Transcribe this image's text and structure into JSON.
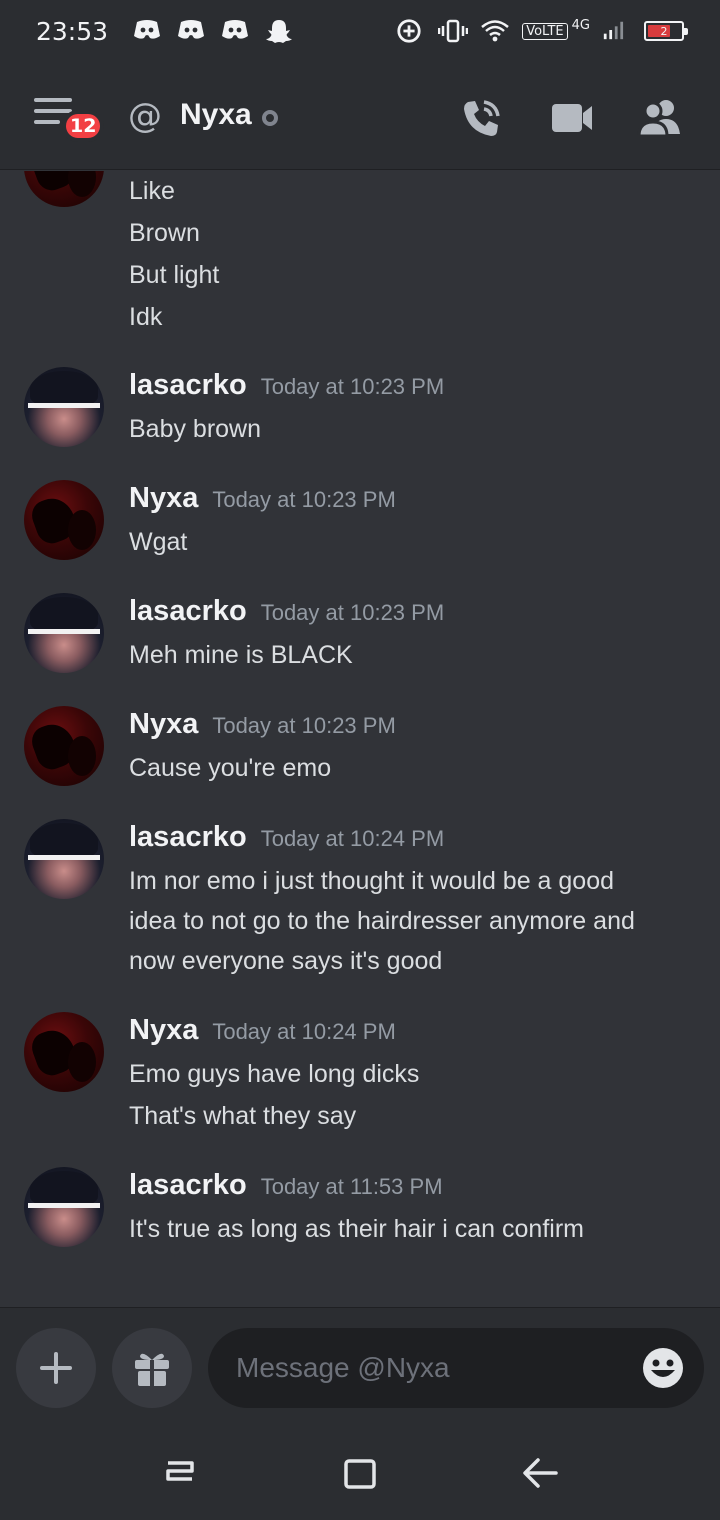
{
  "status_bar": {
    "time": "23:53",
    "notification_icons": [
      "discord-icon",
      "discord-icon",
      "discord-icon",
      "snapchat-icon"
    ],
    "network": "VoLTE",
    "network_type": "4G",
    "battery_level": "2",
    "battery_color": "#d83c3e"
  },
  "header": {
    "unread_badge": "12",
    "channel_prefix": "@",
    "name": "Nyxa",
    "status": "offline",
    "icons": [
      "menu-icon",
      "phone-call-icon",
      "video-call-icon",
      "members-icon"
    ]
  },
  "messages": [
    {
      "author": "",
      "avatar": "nyxa",
      "timestamp": "",
      "lines": [
        "Like",
        "Brown",
        "But light",
        "Idk"
      ]
    },
    {
      "author": "lasacrko",
      "avatar": "lasacrko",
      "timestamp": "Today at 10:23 PM",
      "lines": [
        "Baby brown"
      ]
    },
    {
      "author": "Nyxa",
      "avatar": "nyxa",
      "timestamp": "Today at 10:23 PM",
      "lines": [
        "Wgat"
      ]
    },
    {
      "author": "lasacrko",
      "avatar": "lasacrko",
      "timestamp": "Today at 10:23 PM",
      "lines": [
        "Meh mine is BLACK"
      ]
    },
    {
      "author": "Nyxa",
      "avatar": "nyxa",
      "timestamp": "Today at 10:23 PM",
      "lines": [
        "Cause you're emo"
      ]
    },
    {
      "author": "lasacrko",
      "avatar": "lasacrko",
      "timestamp": "Today at 10:24 PM",
      "lines": [
        "Im nor emo i just thought it would be a good",
        "idea to not go to the hairdresser anymore and",
        "now everyone says it's good"
      ]
    },
    {
      "author": "Nyxa",
      "avatar": "nyxa",
      "timestamp": "Today at 10:24 PM",
      "lines": [
        "Emo guys have long dicks",
        "That's what they say"
      ]
    },
    {
      "author": "lasacrko",
      "avatar": "lasacrko",
      "timestamp": "Today at 11:53 PM",
      "lines": [
        "It's true as long as their hair i can confirm"
      ]
    }
  ],
  "composer": {
    "placeholder": "Message @Nyxa",
    "value": "",
    "icons": [
      "plus-icon",
      "gift-icon",
      "emoji-icon"
    ]
  },
  "nav_bar": {
    "icons": [
      "recents-icon",
      "home-icon",
      "back-icon"
    ]
  },
  "colors": {
    "background": "#313338",
    "header": "#2b2d31",
    "danger": "#f23f43"
  }
}
